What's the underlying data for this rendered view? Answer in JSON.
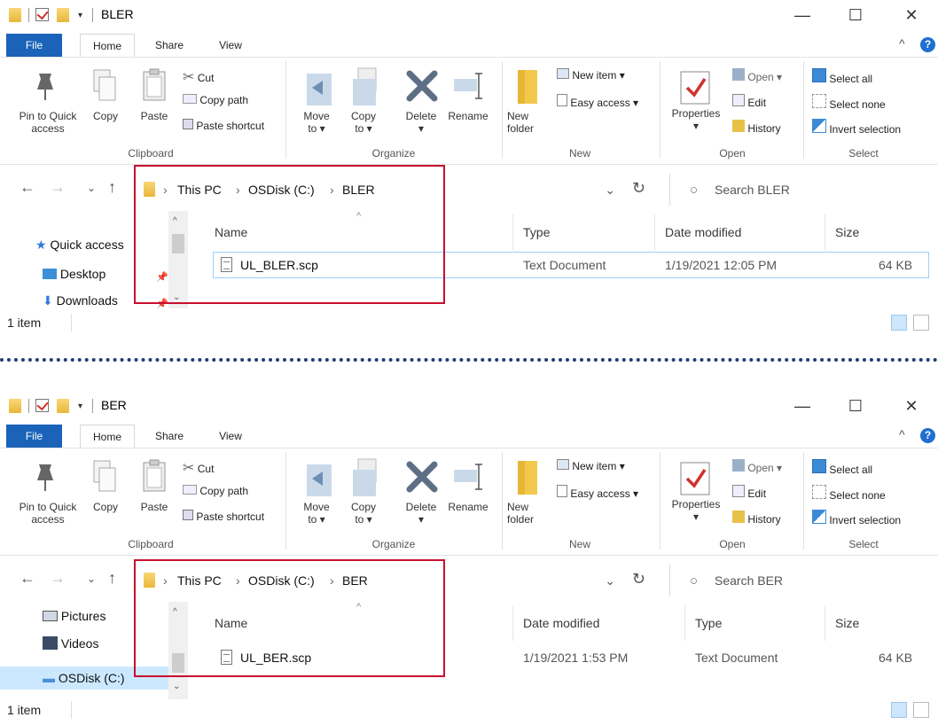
{
  "windows": [
    {
      "title": "BLER",
      "tabs": {
        "file": "File",
        "home": "Home",
        "share": "Share",
        "view": "View"
      },
      "ribbon": {
        "pin": "Pin to Quick access",
        "copy": "Copy",
        "paste": "Paste",
        "cut": "Cut",
        "copy_path": "Copy path",
        "paste_shortcut": "Paste shortcut",
        "move_to": "Move to",
        "copy_to": "Copy to",
        "delete": "Delete",
        "rename": "Rename",
        "new_folder": "New folder",
        "new_item": "New item",
        "easy_access": "Easy access",
        "properties": "Properties",
        "open": "Open",
        "edit": "Edit",
        "history": "History",
        "select_all": "Select all",
        "select_none": "Select none",
        "invert_selection": "Invert selection",
        "groups": {
          "clipboard": "Clipboard",
          "organize": "Organize",
          "new": "New",
          "open": "Open",
          "select": "Select"
        }
      },
      "breadcrumb": [
        "This PC",
        "OSDisk (C:)",
        "BLER"
      ],
      "search_placeholder": "Search BLER",
      "nav_items": [
        "Quick access",
        "Desktop",
        "Downloads"
      ],
      "columns": [
        "Name",
        "Type",
        "Date modified",
        "Size"
      ],
      "file": {
        "name": "UL_BLER.scp",
        "type": "Text Document",
        "date": "1/19/2021 12:05 PM",
        "size": "64 KB"
      },
      "status": "1 item"
    },
    {
      "title": "BER",
      "tabs": {
        "file": "File",
        "home": "Home",
        "share": "Share",
        "view": "View"
      },
      "ribbon": {
        "pin": "Pin to Quick access",
        "copy": "Copy",
        "paste": "Paste",
        "cut": "Cut",
        "copy_path": "Copy path",
        "paste_shortcut": "Paste shortcut",
        "move_to": "Move to",
        "copy_to": "Copy to",
        "delete": "Delete",
        "rename": "Rename",
        "new_folder": "New folder",
        "new_item": "New item",
        "easy_access": "Easy access",
        "properties": "Properties",
        "open": "Open",
        "edit": "Edit",
        "history": "History",
        "select_all": "Select all",
        "select_none": "Select none",
        "invert_selection": "Invert selection",
        "groups": {
          "clipboard": "Clipboard",
          "organize": "Organize",
          "new": "New",
          "open": "Open",
          "select": "Select"
        }
      },
      "breadcrumb": [
        "This PC",
        "OSDisk (C:)",
        "BER"
      ],
      "search_placeholder": "Search BER",
      "nav_items": [
        "Pictures",
        "Videos",
        "OSDisk (C:)"
      ],
      "columns": [
        "Name",
        "Date modified",
        "Type",
        "Size"
      ],
      "file": {
        "name": "UL_BER.scp",
        "date": "1/19/2021 1:53 PM",
        "type": "Text Document",
        "size": "64 KB"
      },
      "status": "1 item"
    }
  ],
  "colors": {
    "file_tab": "#1a63b8",
    "highlight_box": "#c8102e",
    "selection": "#cce8ff",
    "separator": "#1f3d7a"
  }
}
